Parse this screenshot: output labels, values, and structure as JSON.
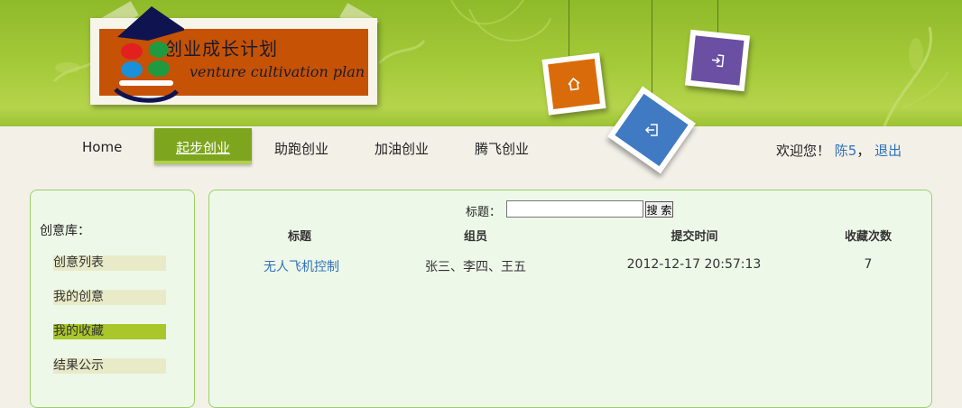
{
  "logo": {
    "title_cn": "创业成长计划",
    "title_en": "venture cultivation plan"
  },
  "hanging_cards": [
    {
      "icon": "home-icon",
      "color": "#d96b0a"
    },
    {
      "icon": "login-icon",
      "color": "#6a4fa3"
    },
    {
      "icon": "logout-icon",
      "color": "#3f7ac2"
    }
  ],
  "nav": {
    "items": [
      {
        "label": "Home"
      },
      {
        "label": "起步创业"
      },
      {
        "label": "助跑创业"
      },
      {
        "label": "加油创业"
      },
      {
        "label": "腾飞创业"
      }
    ],
    "active_index": 1
  },
  "user": {
    "greeting": "欢迎您！",
    "name": "陈5",
    "separator": "，",
    "logout": "退出"
  },
  "sidebar": {
    "title": "创意库：",
    "items": [
      {
        "label": "创意列表"
      },
      {
        "label": "我的创意"
      },
      {
        "label": "我的收藏"
      },
      {
        "label": "结果公示"
      }
    ],
    "active_index": 2
  },
  "search": {
    "label": "标题：",
    "value": "",
    "button": "搜 索"
  },
  "table": {
    "headers": [
      "标题",
      "组员",
      "提交时间",
      "收藏次数"
    ],
    "rows": [
      [
        "无人飞机控制",
        "张三、李四、王五",
        "2012-12-17 20:57:13",
        "7"
      ]
    ]
  },
  "colors": {
    "header_green": "#a6cb3a",
    "nav_active": "#7da51e",
    "link": "#2f72b8",
    "panel_bg": "#eef8e8"
  }
}
